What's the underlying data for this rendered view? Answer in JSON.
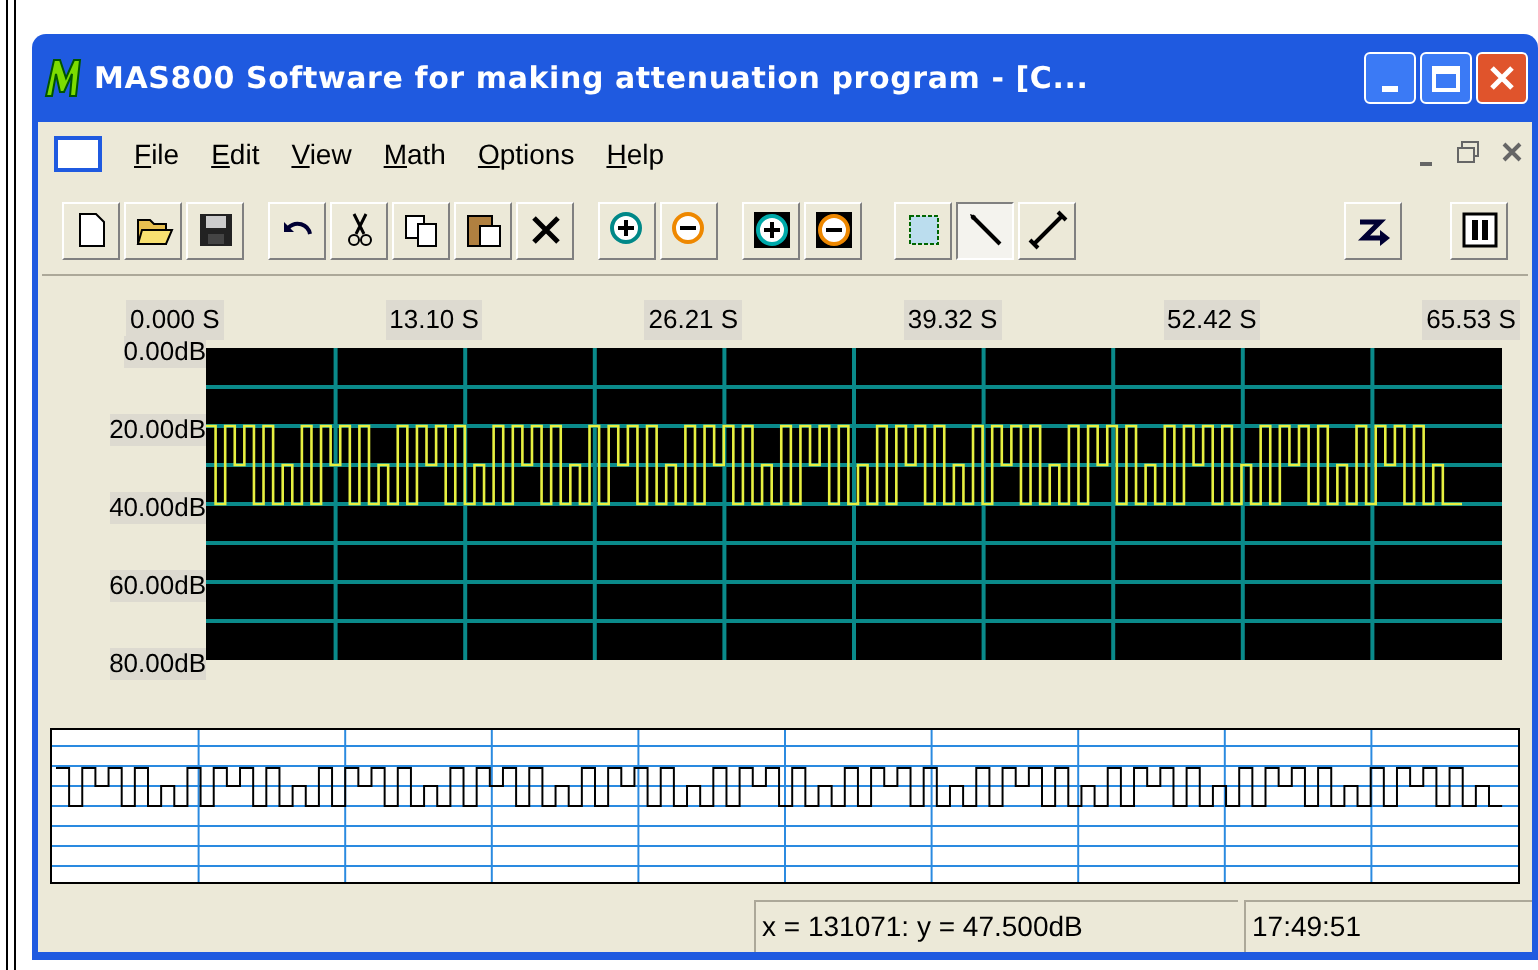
{
  "window": {
    "title": "MAS800 Software for making attenuation program - [C..."
  },
  "menu": [
    {
      "label": "File"
    },
    {
      "label": "Edit"
    },
    {
      "label": "View"
    },
    {
      "label": "Math"
    },
    {
      "label": "Options"
    },
    {
      "label": "Help"
    }
  ],
  "toolbar": [
    {
      "tools": [
        {
          "kind": "new",
          "selected": false
        },
        {
          "kind": "open",
          "selected": false
        },
        {
          "kind": "save",
          "selected": false
        }
      ]
    },
    {
      "tools": [
        {
          "kind": "undo",
          "selected": false
        },
        {
          "kind": "cut",
          "selected": false
        },
        {
          "kind": "copy",
          "selected": false
        },
        {
          "kind": "paste",
          "selected": false
        },
        {
          "kind": "delete",
          "selected": false
        }
      ]
    },
    {
      "tools": [
        {
          "kind": "zoom-in",
          "selected": false
        },
        {
          "kind": "zoom-out",
          "selected": false
        }
      ]
    },
    {
      "tools": [
        {
          "kind": "zoom-in-dark",
          "selected": false
        },
        {
          "kind": "zoom-out-dark",
          "selected": false
        }
      ]
    },
    {
      "tools": [
        {
          "kind": "select",
          "selected": false
        },
        {
          "kind": "pencil",
          "selected": true
        },
        {
          "kind": "line",
          "selected": false
        }
      ]
    },
    {
      "tools": [
        {
          "kind": "jump",
          "selected": false
        }
      ]
    },
    {
      "tools": [
        {
          "kind": "pause",
          "selected": false
        }
      ]
    }
  ],
  "chart": {
    "time_labels": [
      "0.000 S",
      "13.10 S",
      "26.21 S",
      "39.32 S",
      "52.42 S",
      "65.53 S"
    ],
    "level_labels": [
      "0.00dB",
      "20.00dB",
      "40.00dB",
      "60.00dB",
      "80.00dB"
    ]
  },
  "status_bar": {
    "panels": [
      "x = 131071: y = 47.500dB",
      "17:49:51"
    ]
  }
}
